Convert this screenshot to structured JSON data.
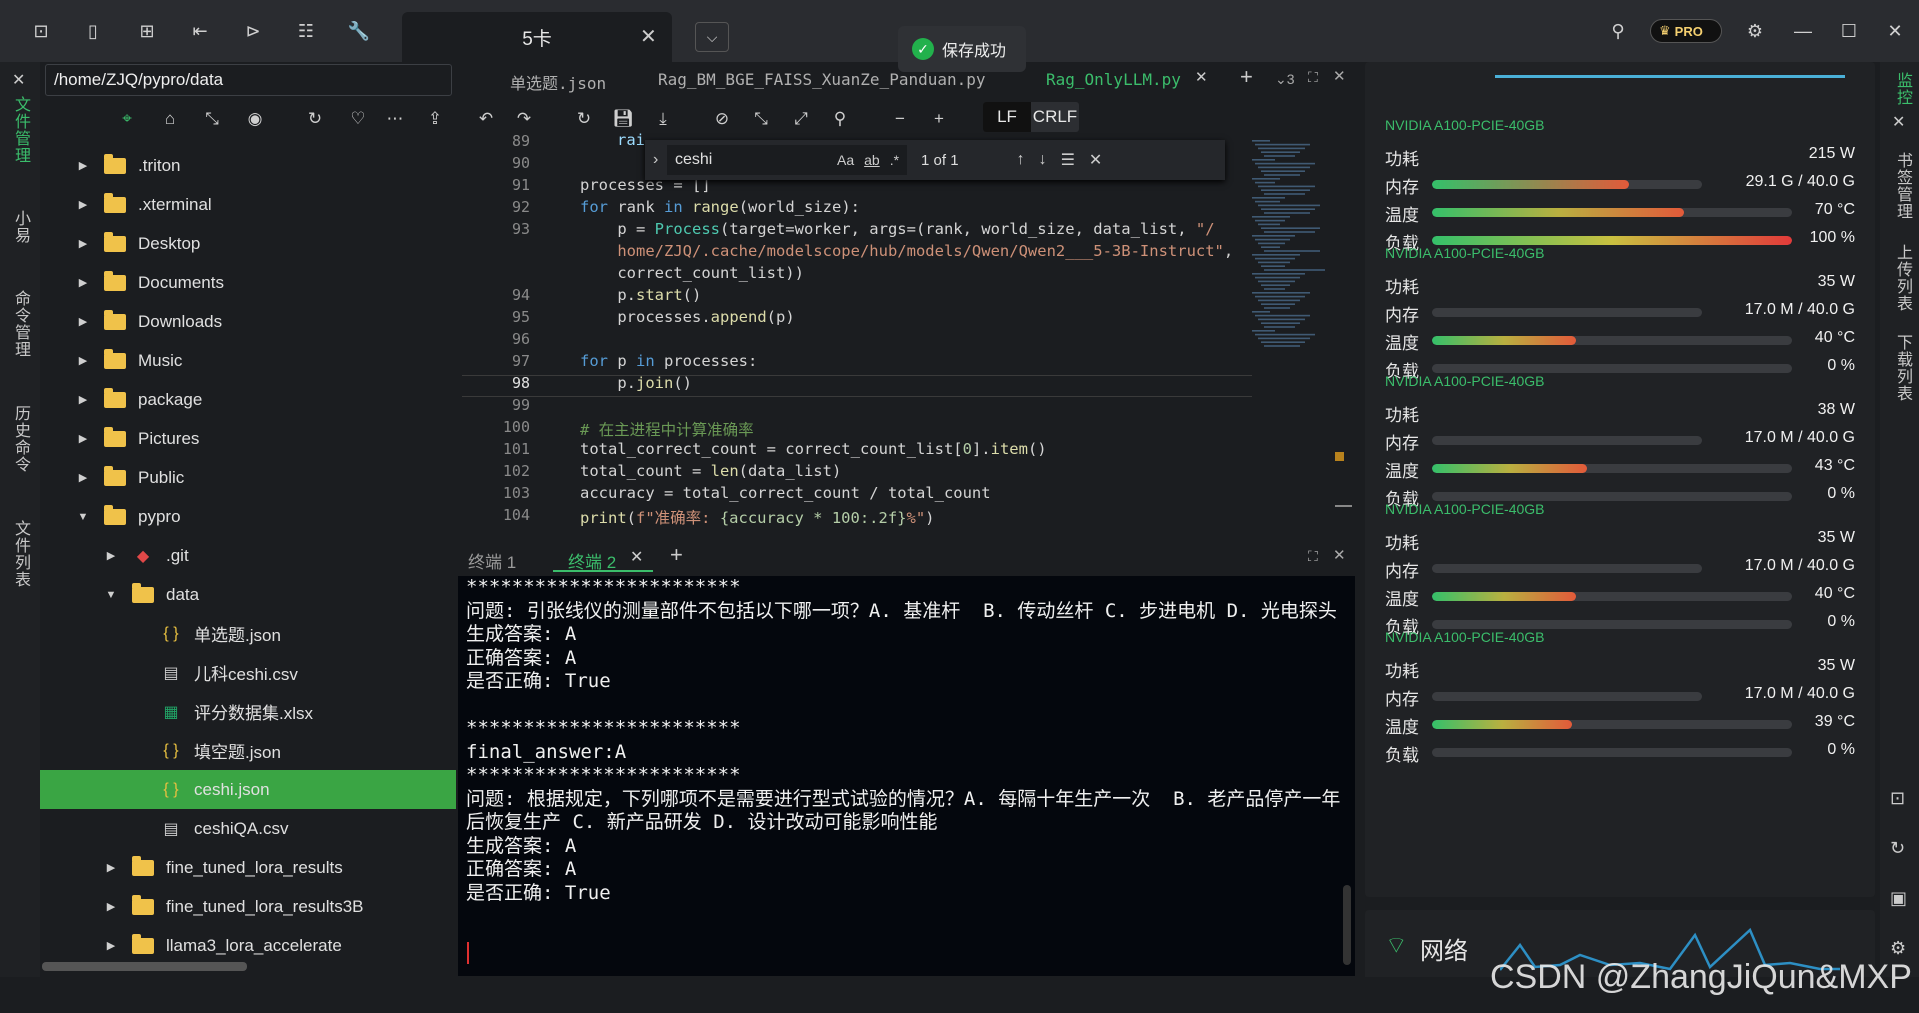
{
  "topbar": {
    "tab_title": "5卡",
    "toast": "保存成功",
    "pro": "PRO"
  },
  "left_rail": [
    "文件管理",
    "小易",
    "命令管理",
    "历史命令",
    "文件列表"
  ],
  "right_rail": [
    "监控",
    "书签管理",
    "上传列表",
    "下载列表"
  ],
  "file_panel": {
    "path": "/home/ZJQ/pypro/data",
    "tree": [
      {
        "name": ".triton",
        "type": "folder",
        "depth": 0,
        "arrow": "▶"
      },
      {
        "name": ".xterminal",
        "type": "folder",
        "depth": 0,
        "arrow": "▶"
      },
      {
        "name": "Desktop",
        "type": "folder",
        "depth": 0,
        "arrow": "▶"
      },
      {
        "name": "Documents",
        "type": "folder",
        "depth": 0,
        "arrow": "▶"
      },
      {
        "name": "Downloads",
        "type": "folder",
        "depth": 0,
        "arrow": "▶"
      },
      {
        "name": "Music",
        "type": "folder",
        "depth": 0,
        "arrow": "▶"
      },
      {
        "name": "package",
        "type": "folder",
        "depth": 0,
        "arrow": "▶"
      },
      {
        "name": "Pictures",
        "type": "folder",
        "depth": 0,
        "arrow": "▶"
      },
      {
        "name": "Public",
        "type": "folder",
        "depth": 0,
        "arrow": "▶"
      },
      {
        "name": "pypro",
        "type": "folder",
        "depth": 0,
        "arrow": "▼"
      },
      {
        "name": ".git",
        "type": "git",
        "depth": 1,
        "arrow": "▶"
      },
      {
        "name": "data",
        "type": "folder",
        "depth": 1,
        "arrow": "▼"
      },
      {
        "name": "单选题.json",
        "type": "json",
        "depth": 2,
        "arrow": ""
      },
      {
        "name": "儿科ceshi.csv",
        "type": "csv",
        "depth": 2,
        "arrow": ""
      },
      {
        "name": "评分数据集.xlsx",
        "type": "xlsx",
        "depth": 2,
        "arrow": ""
      },
      {
        "name": "填空题.json",
        "type": "json",
        "depth": 2,
        "arrow": ""
      },
      {
        "name": "ceshi.json",
        "type": "json",
        "depth": 2,
        "arrow": "",
        "selected": true
      },
      {
        "name": "ceshiQA.csv",
        "type": "csv",
        "depth": 2,
        "arrow": ""
      },
      {
        "name": "fine_tuned_lora_results",
        "type": "folder",
        "depth": 1,
        "arrow": "▶"
      },
      {
        "name": "fine_tuned_lora_results3B",
        "type": "folder",
        "depth": 1,
        "arrow": "▶"
      },
      {
        "name": "llama3_lora_accelerate",
        "type": "folder",
        "depth": 1,
        "arrow": "▶"
      }
    ]
  },
  "editor": {
    "tabs": [
      "单选题.json",
      "Rag_BM_BGE_FAISS_XuanZe_Panduan.py",
      "Rag_OnlyLLM.py"
    ],
    "tab_count": "3",
    "lf": "LF",
    "crlf": "CRLF",
    "find": {
      "query": "ceshi",
      "case": "Aa",
      "word": "ab",
      "regex": ".*",
      "result": "1 of 1"
    },
    "line_numbers": [
      "89",
      "90",
      "91",
      "92",
      "93",
      "",
      "",
      "94",
      "95",
      "96",
      "97",
      "98",
      "99",
      "100",
      "101",
      "102",
      "103",
      "104"
    ]
  },
  "terminal": {
    "tabs": [
      "终端 1",
      "终端 2"
    ],
    "text": "************************\n问题: 引张线仪的测量部件不包括以下哪一项？A. 基准杆  B. 传动丝杆 C. 步进电机 D. 光电探头\n生成答案: A\n正确答案: A\n是否正确: True\n\n************************\nfinal_answer:A\n************************\n问题: 根据规定，下列哪项不是需要进行型式试验的情况？A. 每隔十年生产一次  B. 老产品停产一年后恢复生产 C. 新产品研发 D. 设计改动可能影响性能\n生成答案: A\n正确答案: A\n是否正确: True"
  },
  "gpu": {
    "labels": {
      "power": "功耗",
      "mem": "内存",
      "temp": "温度",
      "load": "负载"
    },
    "cards": [
      {
        "name": "NVIDIA A100-PCIE-40GB",
        "power": "215 W",
        "mem": "29.1 G / 40.0 G",
        "mem_frac": 0.73,
        "temp": "70 °C",
        "temp_frac": 0.7,
        "load": "100 %",
        "load_frac": 1.0
      },
      {
        "name": "NVIDIA A100-PCIE-40GB",
        "power": "35 W",
        "mem": "17.0 M / 40.0 G",
        "mem_frac": 0.0,
        "temp": "40 °C",
        "temp_frac": 0.4,
        "load": "0 %",
        "load_frac": 0
      },
      {
        "name": "NVIDIA A100-PCIE-40GB",
        "power": "38 W",
        "mem": "17.0 M / 40.0 G",
        "mem_frac": 0.0,
        "temp": "43 °C",
        "temp_frac": 0.43,
        "load": "0 %",
        "load_frac": 0
      },
      {
        "name": "NVIDIA A100-PCIE-40GB",
        "power": "35 W",
        "mem": "17.0 M / 40.0 G",
        "mem_frac": 0.0,
        "temp": "40 °C",
        "temp_frac": 0.4,
        "load": "0 %",
        "load_frac": 0
      },
      {
        "name": "NVIDIA A100-PCIE-40GB",
        "power": "35 W",
        "mem": "17.0 M / 40.0 G",
        "mem_frac": 0.0,
        "temp": "39 °C",
        "temp_frac": 0.39,
        "load": "0 %",
        "load_frac": 0
      }
    ]
  },
  "network": {
    "label": "网络"
  },
  "watermark": "CSDN @ZhangJiQun&MXP"
}
